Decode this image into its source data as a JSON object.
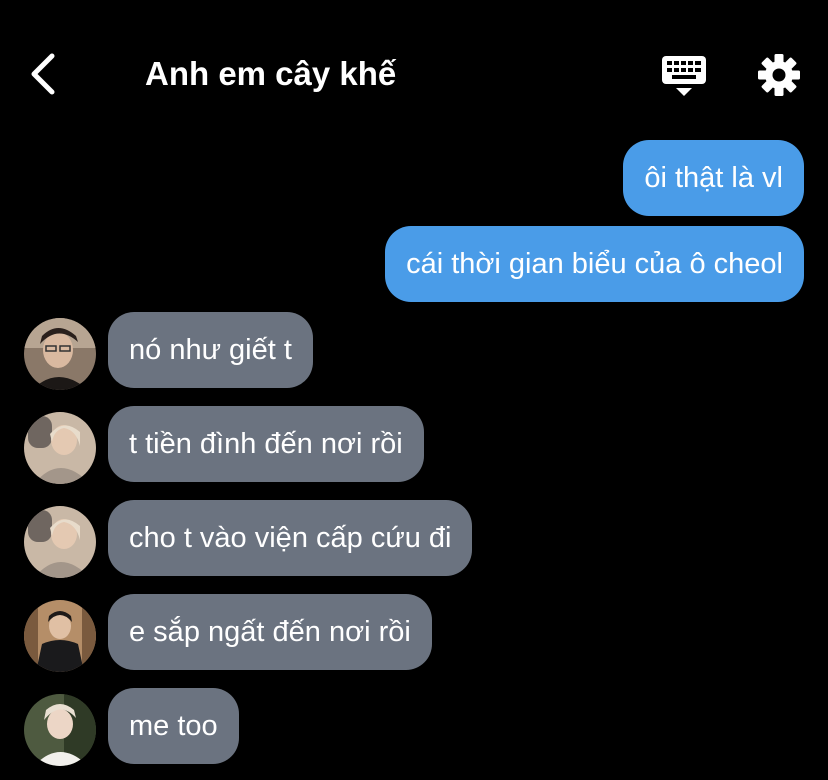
{
  "header": {
    "title": "Anh em cây khế",
    "back_icon": "chevron-left-icon",
    "keyboard_icon": "keyboard-icon",
    "settings_icon": "gear-icon"
  },
  "colors": {
    "background": "#000000",
    "outgoing_bubble": "#4a9ce8",
    "incoming_bubble": "#6b7380",
    "text": "#ffffff"
  },
  "messages": [
    {
      "direction": "outgoing",
      "text": "ôi thật là vl"
    },
    {
      "direction": "outgoing",
      "text": "cái thời gian biểu của ô cheol"
    },
    {
      "direction": "incoming",
      "text": "nó như giết t"
    },
    {
      "direction": "incoming",
      "text": "t tiền đình đến nơi rồi"
    },
    {
      "direction": "incoming",
      "text": "cho t vào viện cấp cứu đi"
    },
    {
      "direction": "incoming",
      "text": "e sắp ngất đến nơi rồi"
    },
    {
      "direction": "incoming",
      "text": "me too"
    }
  ]
}
